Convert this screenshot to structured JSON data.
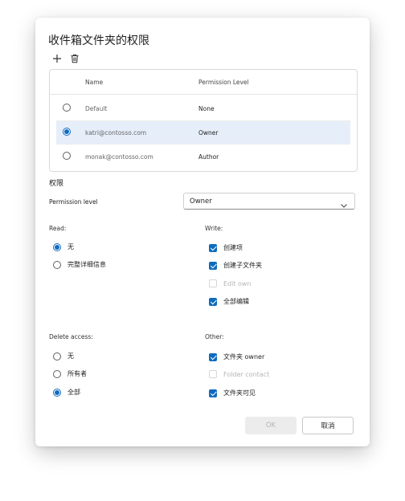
{
  "dialog": {
    "title": "收件箱文件夹的权限",
    "toolbar": {
      "add_icon": "plus-icon",
      "delete_icon": "trash-icon"
    }
  },
  "users_table": {
    "columns": {
      "name": "Name",
      "permission": "Permission Level"
    },
    "rows": [
      {
        "name": "Default",
        "permission": "None",
        "selected": false
      },
      {
        "name": "katri@contosso.com",
        "permission": "Owner",
        "selected": true
      },
      {
        "name": "monak@contosso.com",
        "permission": "Author",
        "selected": false
      }
    ]
  },
  "permissions": {
    "section_title": "权限",
    "level_label": "Permission level",
    "level_value": "Owner"
  },
  "read": {
    "label": "Read:",
    "options": [
      {
        "label": "无",
        "checked": true
      },
      {
        "label": "完整详细信息",
        "checked": false
      }
    ]
  },
  "write": {
    "label": "Write:",
    "options": [
      {
        "label": "创建项",
        "checked": true,
        "disabled": false
      },
      {
        "label": "创建子文件夹",
        "checked": true,
        "disabled": false
      },
      {
        "label": "Edit own",
        "checked": false,
        "disabled": true
      },
      {
        "label": "全部编辑",
        "checked": true,
        "disabled": false
      }
    ]
  },
  "delete_access": {
    "label": "Delete access:",
    "options": [
      {
        "label": "无",
        "checked": false
      },
      {
        "label": "所有者",
        "checked": false
      },
      {
        "label": "全部",
        "checked": true
      }
    ]
  },
  "other": {
    "label": "Other:",
    "options": [
      {
        "label": "文件夹 owner",
        "checked": true,
        "disabled": false
      },
      {
        "label": "Folder contact",
        "checked": false,
        "disabled": true
      },
      {
        "label": "文件夹可见",
        "checked": true,
        "disabled": false
      }
    ]
  },
  "buttons": {
    "ok": "OK",
    "cancel": "取消"
  },
  "colors": {
    "accent": "#0f6cbd",
    "selected_row": "#e6eefa"
  }
}
